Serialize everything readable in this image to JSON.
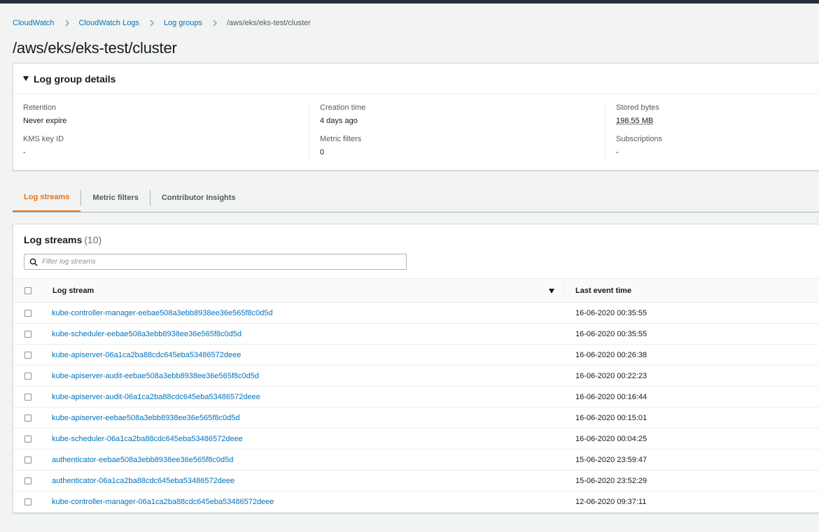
{
  "breadcrumb": {
    "items": [
      "CloudWatch",
      "CloudWatch Logs",
      "Log groups"
    ],
    "current": "/aws/eks/eks-test/cluster"
  },
  "page_title": "/aws/eks/eks-test/cluster",
  "details": {
    "header": "Log group details",
    "retention_label": "Retention",
    "retention_value": "Never expire",
    "kms_label": "KMS key ID",
    "kms_value": "-",
    "creation_label": "Creation time",
    "creation_value": "4 days ago",
    "metric_filters_label": "Metric filters",
    "metric_filters_value": "0",
    "stored_label": "Stored bytes",
    "stored_value": "198.55 MB",
    "subscriptions_label": "Subscriptions",
    "subscriptions_value": "-"
  },
  "tabs": [
    {
      "label": "Log streams",
      "active": true
    },
    {
      "label": "Metric filters",
      "active": false
    },
    {
      "label": "Contributor Insights",
      "active": false
    }
  ],
  "streams": {
    "title": "Log streams",
    "count": "(10)",
    "filter_placeholder": "Filter log streams",
    "col_stream": "Log stream",
    "col_time": "Last event time",
    "rows": [
      {
        "name": "kube-controller-manager-eebae508a3ebb8938ee36e565f8c0d5d",
        "time": "16-06-2020 00:35:55"
      },
      {
        "name": "kube-scheduler-eebae508a3ebb8938ee36e565f8c0d5d",
        "time": "16-06-2020 00:35:55"
      },
      {
        "name": "kube-apiserver-06a1ca2ba88cdc645eba53486572deee",
        "time": "16-06-2020 00:26:38"
      },
      {
        "name": "kube-apiserver-audit-eebae508a3ebb8938ee36e565f8c0d5d",
        "time": "16-06-2020 00:22:23"
      },
      {
        "name": "kube-apiserver-audit-06a1ca2ba88cdc645eba53486572deee",
        "time": "16-06-2020 00:16:44"
      },
      {
        "name": "kube-apiserver-eebae508a3ebb8938ee36e565f8c0d5d",
        "time": "16-06-2020 00:15:01"
      },
      {
        "name": "kube-scheduler-06a1ca2ba88cdc645eba53486572deee",
        "time": "16-06-2020 00:04:25"
      },
      {
        "name": "authenticator-eebae508a3ebb8938ee36e565f8c0d5d",
        "time": "15-06-2020 23:59:47"
      },
      {
        "name": "authenticator-06a1ca2ba88cdc645eba53486572deee",
        "time": "15-06-2020 23:52:29"
      },
      {
        "name": "kube-controller-manager-06a1ca2ba88cdc645eba53486572deee",
        "time": "12-06-2020 09:37:11"
      }
    ]
  },
  "colors": {
    "link": "#0073bb",
    "active_tab": "#ec7211",
    "topbar": "#232f3e",
    "background": "#f2f3f3"
  },
  "icons": {
    "breadcrumb_separator": "chevron-right-icon",
    "expand": "caret-down-icon",
    "search": "search-icon",
    "sort": "sort-down-icon"
  }
}
